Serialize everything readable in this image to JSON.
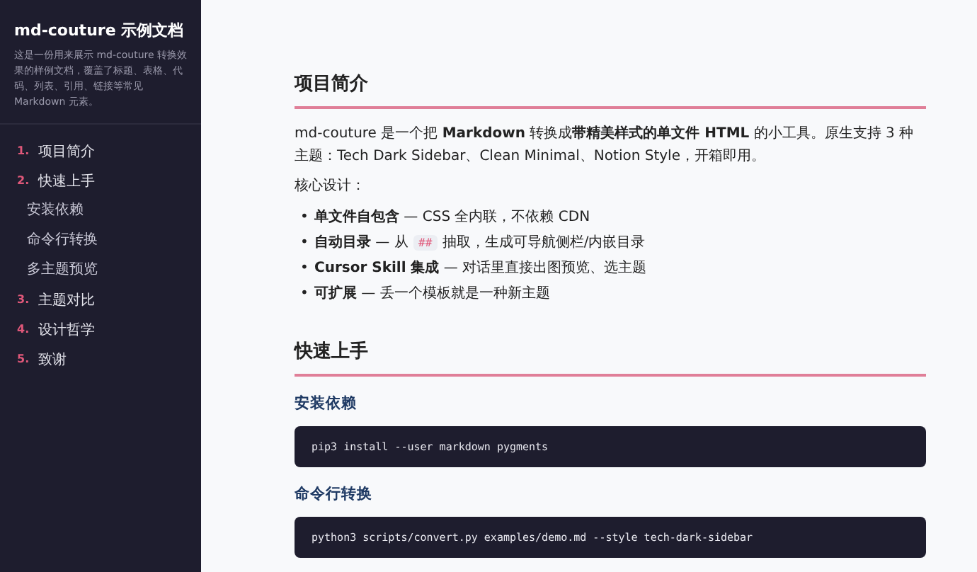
{
  "sidebar": {
    "title": "md-couture 示例文档",
    "description": "这是一份用来展示 md-couture 转换效果的样例文档，覆盖了标题、表格、代码、列表、引用、链接等常见 Markdown 元素。",
    "toc": [
      {
        "number": "1.",
        "label": "项目简介"
      },
      {
        "number": "2.",
        "label": "快速上手",
        "children": [
          {
            "label": "安装依赖"
          },
          {
            "label": "命令行转换"
          },
          {
            "label": "多主题预览"
          }
        ]
      },
      {
        "number": "3.",
        "label": "主题对比"
      },
      {
        "number": "4.",
        "label": "设计哲学"
      },
      {
        "number": "5.",
        "label": "致谢"
      }
    ]
  },
  "content": [
    {
      "kind": "h2",
      "text": "项目简介"
    },
    {
      "kind": "p",
      "text": "md-couture 是一个把 **Markdown** 转换成**带精美样式的单文件 HTML** 的小工具。原生支持 3 种主题：Tech Dark Sidebar、Clean Minimal、Notion Style，开箱即用。"
    },
    {
      "kind": "p",
      "text": "核心设计："
    },
    {
      "kind": "ul",
      "items": [
        {
          "bullet": "•",
          "parts": [
            {
              "kind": "text",
              "text": "**单文件自包含** — CSS 全内联，不依赖 CDN"
            }
          ]
        },
        {
          "bullet": "•",
          "parts": [
            {
              "kind": "text",
              "text": "**自动目录** — 从 "
            },
            {
              "kind": "code",
              "text": "##"
            },
            {
              "kind": "text",
              "text": " 抽取，生成可导航侧栏/内嵌目录"
            }
          ]
        },
        {
          "bullet": "•",
          "parts": [
            {
              "kind": "text",
              "text": "**Cursor Skill 集成** — 对话里直接出图预览、选主题"
            }
          ]
        },
        {
          "bullet": "•",
          "parts": [
            {
              "kind": "text",
              "text": "**可扩展** — 丢一个模板就是一种新主题"
            }
          ]
        }
      ]
    },
    {
      "kind": "h2",
      "text": "快速上手"
    },
    {
      "kind": "h3",
      "text": "安装依赖"
    },
    {
      "kind": "pre",
      "text": "pip3 install --user markdown pygments"
    },
    {
      "kind": "h3",
      "text": "命令行转换"
    },
    {
      "kind": "pre",
      "text": "python3 scripts/convert.py examples/demo.md --style tech-dark-sidebar"
    }
  ]
}
